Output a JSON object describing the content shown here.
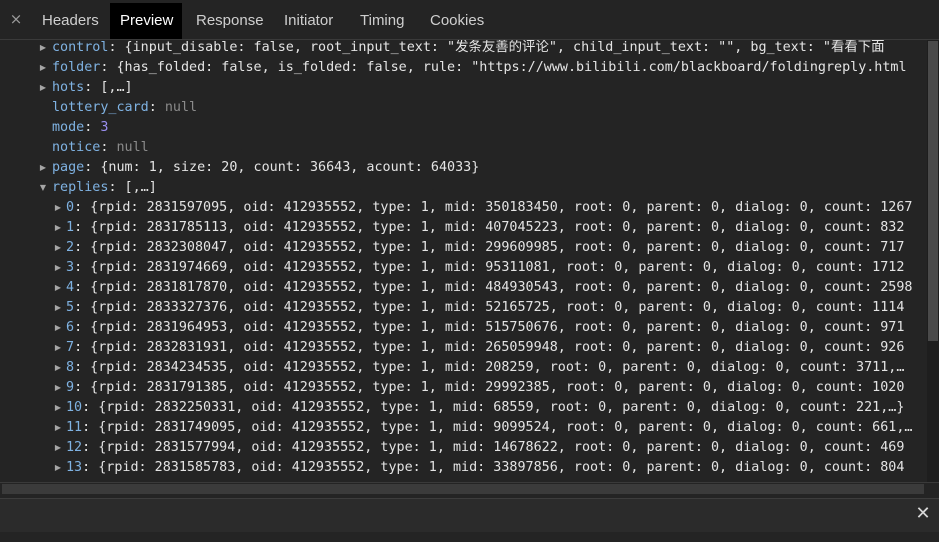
{
  "tabs": {
    "close_glyph": "×",
    "items": [
      {
        "label": "Headers"
      },
      {
        "label": "Preview"
      },
      {
        "label": "Response"
      },
      {
        "label": "Initiator"
      },
      {
        "label": "Timing"
      },
      {
        "label": "Cookies"
      }
    ],
    "active": "Preview"
  },
  "tree": {
    "control": {
      "key": "control",
      "rest": ": {input_disable: false, root_input_text: \"发条友善的评论\", child_input_text: \"\", bg_text: \"看看下面"
    },
    "folder": {
      "key": "folder",
      "rest": ": {has_folded: false, is_folded: false, rule: \"https://www.bilibili.com/blackboard/foldingreply.html"
    },
    "hots": {
      "key": "hots",
      "rest": ": [,…]"
    },
    "lottery_card": {
      "key": "lottery_card",
      "sep": ": ",
      "value": "null"
    },
    "mode": {
      "key": "mode",
      "sep": ": ",
      "value": "3"
    },
    "notice": {
      "key": "notice",
      "sep": ": ",
      "value": "null"
    },
    "page": {
      "key": "page",
      "rest": ": {num: 1, size: 20, count: 36643, acount: 64033}"
    },
    "replies": {
      "key": "replies",
      "rest": ": [,…]"
    },
    "reply_items": [
      {
        "index": "0",
        "text": ": {rpid: 2831597095, oid: 412935552, type: 1, mid: 350183450, root: 0, parent: 0, dialog: 0, count: 1267"
      },
      {
        "index": "1",
        "text": ": {rpid: 2831785113, oid: 412935552, type: 1, mid: 407045223, root: 0, parent: 0, dialog: 0, count: 832"
      },
      {
        "index": "2",
        "text": ": {rpid: 2832308047, oid: 412935552, type: 1, mid: 299609985, root: 0, parent: 0, dialog: 0, count: 717"
      },
      {
        "index": "3",
        "text": ": {rpid: 2831974669, oid: 412935552, type: 1, mid: 95311081, root: 0, parent: 0, dialog: 0, count: 1712"
      },
      {
        "index": "4",
        "text": ": {rpid: 2831817870, oid: 412935552, type: 1, mid: 484930543, root: 0, parent: 0, dialog: 0, count: 2598"
      },
      {
        "index": "5",
        "text": ": {rpid: 2833327376, oid: 412935552, type: 1, mid: 52165725, root: 0, parent: 0, dialog: 0, count: 1114"
      },
      {
        "index": "6",
        "text": ": {rpid: 2831964953, oid: 412935552, type: 1, mid: 515750676, root: 0, parent: 0, dialog: 0, count: 971"
      },
      {
        "index": "7",
        "text": ": {rpid: 2832831931, oid: 412935552, type: 1, mid: 265059948, root: 0, parent: 0, dialog: 0, count: 926"
      },
      {
        "index": "8",
        "text": ": {rpid: 2834234535, oid: 412935552, type: 1, mid: 208259, root: 0, parent: 0, dialog: 0, count: 3711,…"
      },
      {
        "index": "9",
        "text": ": {rpid: 2831791385, oid: 412935552, type: 1, mid: 29992385, root: 0, parent: 0, dialog: 0, count: 1020"
      },
      {
        "index": "10",
        "text": ": {rpid: 2832250331, oid: 412935552, type: 1, mid: 68559, root: 0, parent: 0, dialog: 0, count: 221,…}"
      },
      {
        "index": "11",
        "text": ": {rpid: 2831749095, oid: 412935552, type: 1, mid: 9099524, root: 0, parent: 0, dialog: 0, count: 661,…"
      },
      {
        "index": "12",
        "text": ": {rpid: 2831577994, oid: 412935552, type: 1, mid: 14678622, root: 0, parent: 0, dialog: 0, count: 469"
      },
      {
        "index": "13",
        "text": ": {rpid: 2831585783, oid: 412935552, type: 1, mid: 33897856, root: 0, parent: 0, dialog: 0, count: 804"
      }
    ]
  },
  "icons": {
    "collapsed": "▶",
    "expanded": "▼",
    "close": "✕"
  },
  "colors": {
    "key": "#7fb2e2",
    "number": "#9a8ff0",
    "null": "#8a8a8a",
    "text": "#e4e4e4",
    "background": "#242424",
    "active_tab": "#000000"
  }
}
